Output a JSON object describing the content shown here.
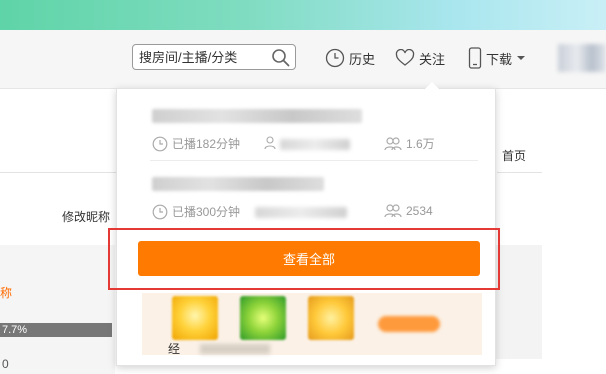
{
  "search": {
    "placeholder": "搜房间/主播/分类"
  },
  "nav": {
    "history": "历史",
    "follow": "关注",
    "download": "下载"
  },
  "dropdown": {
    "items": [
      {
        "duration": "已播182分钟",
        "viewers": "1.6万"
      },
      {
        "duration": "已播300分钟",
        "viewers": "2534"
      }
    ],
    "view_all": "查看全部"
  },
  "page": {
    "modify_nickname": "修改昵称",
    "home": "首页",
    "orange_text": "称",
    "progress_text": "7.7%",
    "zero_value": "0",
    "gift_label": "经"
  },
  "colors": {
    "accent": "#ff7a00",
    "highlight_border": "#e53935"
  },
  "icons": [
    "search-icon",
    "clock-icon",
    "heart-icon",
    "phone-icon",
    "chevron-down-icon",
    "person-icon",
    "people-icon"
  ]
}
